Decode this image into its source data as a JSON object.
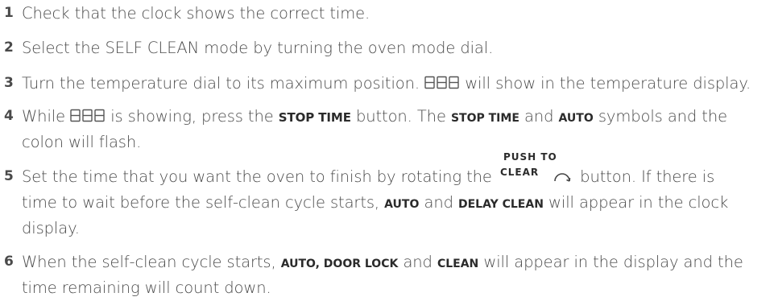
{
  "steps": [
    {
      "number": "1",
      "text": "Check that the clock shows the correct time."
    },
    {
      "number": "2",
      "text": "Select the SELF CLEAN mode by turning the oven mode dial."
    },
    {
      "number": "3",
      "text_a": "Turn the temperature dial to its maximum position.",
      "text_b": "will show in the temperature display."
    },
    {
      "number": "4",
      "text_a": "While",
      "text_b": "is showing, press the",
      "kw_stop_time": "STOP TIME",
      "text_c": "button.  The",
      "kw_stop_time_2": "STOP TIME",
      "text_d": "and",
      "kw_auto": "AUTO",
      "text_e": "symbols and the",
      "text_f": "colon will flash."
    },
    {
      "number": "5",
      "text_a": "Set the time that you want the oven to finish by rotating the",
      "kw_push_to": "PUSH TO",
      "kw_clear": "CLEAR",
      "text_b": "button.  If there is",
      "text_c": "time to wait before the self-clean cycle starts,",
      "kw_auto": "AUTO",
      "text_d": "and",
      "kw_delay_clean": "DELAY CLEAN",
      "text_e": "will appear in the clock",
      "text_f": "display."
    },
    {
      "number": "6",
      "text_a": "When the self-clean cycle starts,",
      "kw_auto_door_lock": "AUTO, DOOR LOCK",
      "text_b": "and",
      "kw_clean": "CLEAN",
      "text_c": "will appear in the display and the",
      "text_d": "time remaining will count down."
    }
  ],
  "icons": {
    "segment_display": "seven-segment-000-icon",
    "rotate_knob": "rotate-arrow-icon"
  }
}
